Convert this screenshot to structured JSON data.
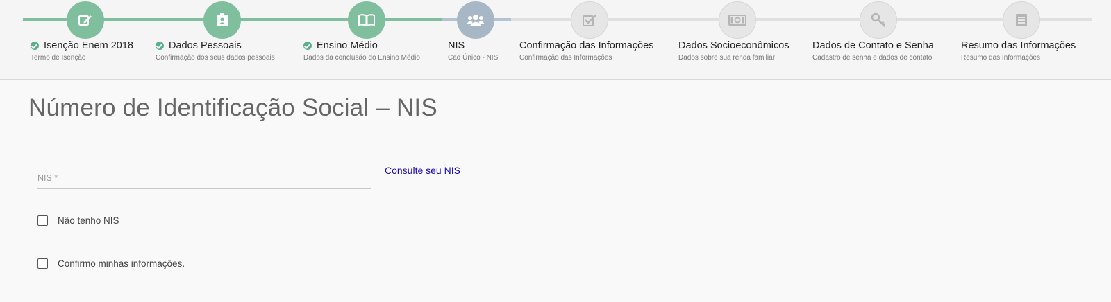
{
  "steps": [
    {
      "title": "Isenção Enem 2018",
      "subtitle": "Termo de Isenção",
      "status": "done",
      "icon": "edit-icon"
    },
    {
      "title": "Dados Pessoais",
      "subtitle": "Confirmação dos seus dados pessoais",
      "status": "done",
      "icon": "id-card-icon"
    },
    {
      "title": "Ensino Médio",
      "subtitle": "Dados da conclusão do Ensino Médio",
      "status": "done",
      "icon": "book-icon"
    },
    {
      "title": "NIS",
      "subtitle": "Cad Único - NIS",
      "status": "current",
      "icon": "users-icon"
    },
    {
      "title": "Confirmação das Informações",
      "subtitle": "Confirmação das Informações",
      "status": "pending",
      "icon": "checkbox-icon"
    },
    {
      "title": "Dados Socioeconômicos",
      "subtitle": "Dados sobre sua renda familiar",
      "status": "pending",
      "icon": "money-icon"
    },
    {
      "title": "Dados de Contato e Senha",
      "subtitle": "Cadastro de senha e dados de contato",
      "status": "pending",
      "icon": "key-icon"
    },
    {
      "title": "Resumo das Informações",
      "subtitle": "Resumo das Informações",
      "status": "pending",
      "icon": "list-icon"
    }
  ],
  "page": {
    "title": "Número de Identificação Social – NIS"
  },
  "form": {
    "nis_label": "NIS *",
    "nis_value": "",
    "consult_link": "Consulte seu NIS",
    "checkbox_no_nis": "Não tenho NIS",
    "checkbox_confirm": "Confirmo minhas informações."
  },
  "colors": {
    "done": "#7fbf9e",
    "current": "#a7b7c5",
    "pending": "#e6e6e6",
    "link": "#1a0dab"
  }
}
